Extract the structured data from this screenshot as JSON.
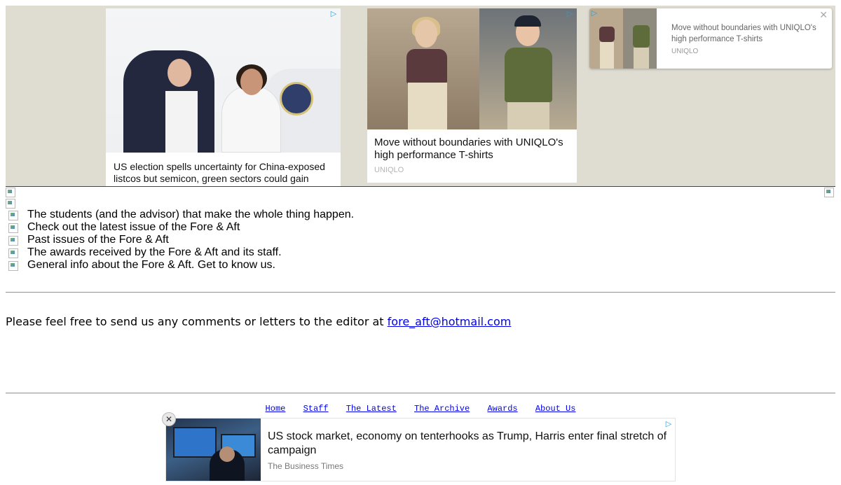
{
  "ads_top": [
    {
      "title": "US election spells uncertainty for China-exposed listcos but semicon, green sectors could gain"
    },
    {
      "title": "Move without boundaries with UNIQLO's high performance T-shirts",
      "brand": "UNIQLO"
    },
    {
      "title": "Move without boundaries with UNIQLO's high performance T-shirts",
      "brand": "UNIQLO"
    }
  ],
  "icons": {
    "adchoices": "▷",
    "close": "✕"
  },
  "nav_list": [
    "The students (and the advisor) that make the whole thing happen.",
    "Check out the latest issue of the Fore & Aft",
    "Past issues of the Fore & Aft",
    "The awards received by the Fore & Aft and its staff.",
    "General info about the Fore & Aft. Get to know us."
  ],
  "contact": {
    "text": "Please feel free to send us any comments or letters to the editor at ",
    "email": "fore_aft@hotmail.com"
  },
  "footer_nav": [
    "Home",
    "Staff",
    "The Latest",
    "The Archive",
    "Awards",
    "About Us"
  ],
  "ad_bottom": {
    "title": "US stock market, economy on tenterhooks as Trump, Harris enter final stretch of campaign",
    "source": "The Business Times",
    "close": "✕"
  }
}
